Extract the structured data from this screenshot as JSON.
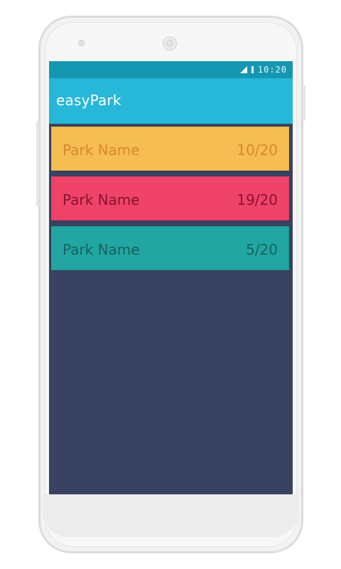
{
  "status_bar": {
    "time": "10:20",
    "icons": [
      "signal-icon",
      "battery-icon"
    ],
    "background": "#1697b1"
  },
  "app_bar": {
    "title": "easyPark",
    "background": "#27b7d8"
  },
  "screen": {
    "background": "#3a4262"
  },
  "parks": [
    {
      "name": "Park Name",
      "count": "10/20",
      "bg": "#f5bd52",
      "fg": "#d9882b"
    },
    {
      "name": "Park Name",
      "count": "19/20",
      "bg": "#f0436a",
      "fg": "#8a1230"
    },
    {
      "name": "Park Name",
      "count": "5/20",
      "bg": "#21a6a1",
      "fg": "#17625f"
    }
  ]
}
